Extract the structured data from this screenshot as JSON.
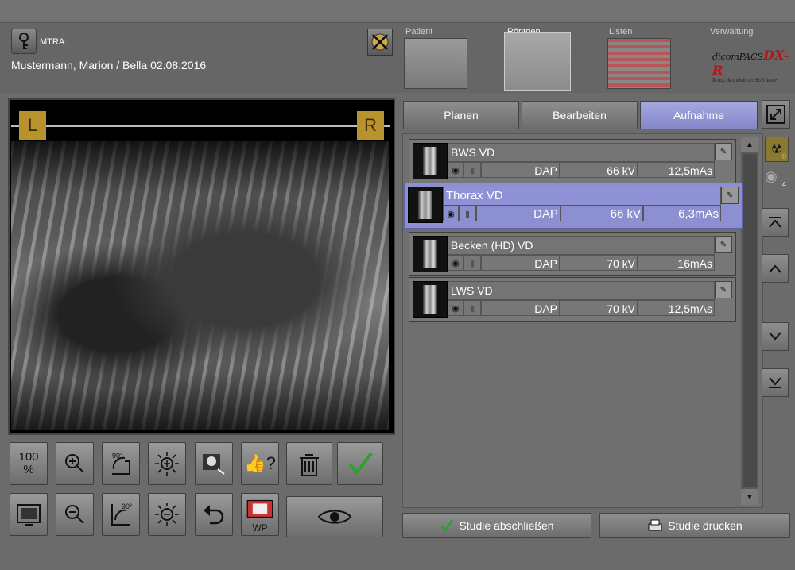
{
  "header": {
    "mtra_label": "MTRA:",
    "patient": "Mustermann, Marion / Bella  02.08.2016",
    "tabs": [
      "Patient",
      "Röntgen",
      "Listen",
      "Verwaltung"
    ],
    "logo": {
      "brand": "dicomPACS",
      "suffix": "DX-R",
      "tagline": "X-ray Acquisition Software"
    }
  },
  "viewer": {
    "marker_left": "L",
    "marker_right": "R"
  },
  "tools": {
    "zoom100": "100\n%",
    "rotate_label": "90°",
    "wp_label": "WP"
  },
  "modes": [
    "Planen",
    "Bearbeiten",
    "Aufnahme"
  ],
  "active_mode": "Aufnahme",
  "exams": [
    {
      "name": "BWS VD",
      "dap": "DAP",
      "kv": "66 kV",
      "mas": "12,5mAs",
      "selected": false
    },
    {
      "name": "Thorax VD",
      "dap": "DAP",
      "kv": "66 kV",
      "mas": "6,3mAs",
      "selected": true
    },
    {
      "name": "Becken (HD) VD",
      "dap": "DAP",
      "kv": "70 kV",
      "mas": "16mAs",
      "selected": false
    },
    {
      "name": "LWS VD",
      "dap": "DAP",
      "kv": "70 kV",
      "mas": "12,5mAs",
      "selected": false
    }
  ],
  "side": {
    "radiation_count": "0",
    "view_count": "4"
  },
  "actions": {
    "close_study": "Studie abschließen",
    "print_study": "Studie drucken"
  },
  "colors": {
    "accent": "#8c8fd0",
    "background": "#6b6b6b",
    "marker": "#b8922d"
  }
}
